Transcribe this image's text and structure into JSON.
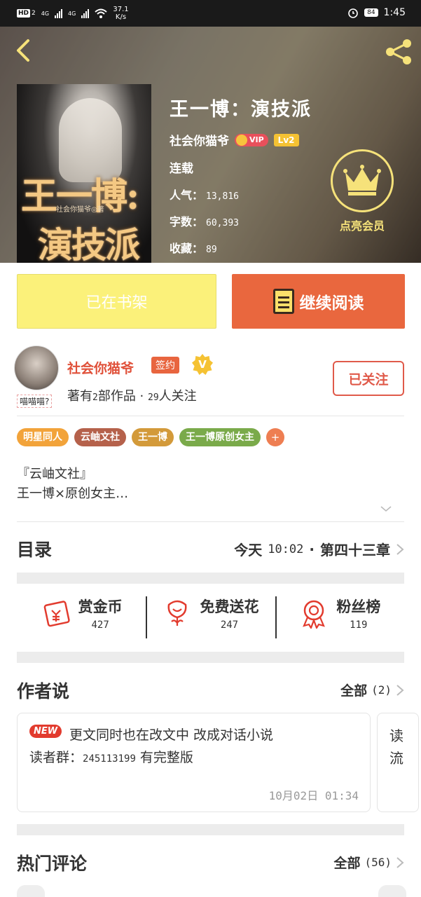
{
  "status_bar": {
    "hd": "HD",
    "sim": "2",
    "net1": "4G",
    "net2": "4G",
    "speed_value": "37.1",
    "speed_unit": "K/s",
    "battery": "84",
    "time": "1:45"
  },
  "book": {
    "title": "王一博：演技派",
    "author": "社会你猫爷",
    "vip": "VIP",
    "level": "Lv2",
    "status": "连载",
    "stats": [
      {
        "label": "人气：",
        "value": "13,816"
      },
      {
        "label": "字数：",
        "value": "60,393"
      },
      {
        "label": "收藏：",
        "value": "89"
      }
    ],
    "cover": {
      "line1": "王一博:",
      "line2": "演技派",
      "sub": "社会你猫爷◎著"
    }
  },
  "member": {
    "label": "点亮会员"
  },
  "buttons": {
    "shelf": "已在书架",
    "read": "继续阅读"
  },
  "author_card": {
    "name": "社会你猫爷",
    "sign": "签约",
    "verified": "V",
    "avatar_tag": "喵喵喵?",
    "works_prefix": "著有",
    "works_count": "2",
    "works_suffix": "部作品 · ",
    "fans_count": "29",
    "fans_suffix": "人关注",
    "follow": "已关注"
  },
  "tags": [
    {
      "label": "明星同人",
      "color": "#f2a33a"
    },
    {
      "label": "云岫文社",
      "color": "#b5614b"
    },
    {
      "label": "王一博",
      "color": "#d39a3a"
    },
    {
      "label": "王一博原创女主",
      "color": "#7aaa4a"
    }
  ],
  "tag_add": "+",
  "synopsis": {
    "line1": "『云岫文社』",
    "line2": "王一博×原创女主…"
  },
  "toc": {
    "title": "目录",
    "day": "今天",
    "time": "10:02",
    "dot": "·",
    "chapter": "第四十三章"
  },
  "actions": [
    {
      "label": "赏金币",
      "count": "427",
      "icon": "coin-envelope-icon"
    },
    {
      "label": "免费送花",
      "count": "247",
      "icon": "flower-icon"
    },
    {
      "label": "粉丝榜",
      "count": "119",
      "icon": "medal-icon"
    }
  ],
  "author_says": {
    "title": "作者说",
    "more": "全部",
    "count": "(2)",
    "new_badge": "NEW",
    "line1": "更文同时也在改文中 改成对话小说",
    "line2_prefix": "读者群：",
    "line2_num": "245113199",
    "line2_suffix": " 有完整版",
    "date": "10月02日  01:34",
    "peek_text": "读\n流"
  },
  "hot_comments": {
    "title": "热门评论",
    "more": "全部",
    "count": "(56)"
  },
  "colors": {
    "accent": "#e9673e",
    "shelf": "#fbf17a",
    "member_gold": "#f6e27a",
    "follow_red": "#e05a4a"
  }
}
